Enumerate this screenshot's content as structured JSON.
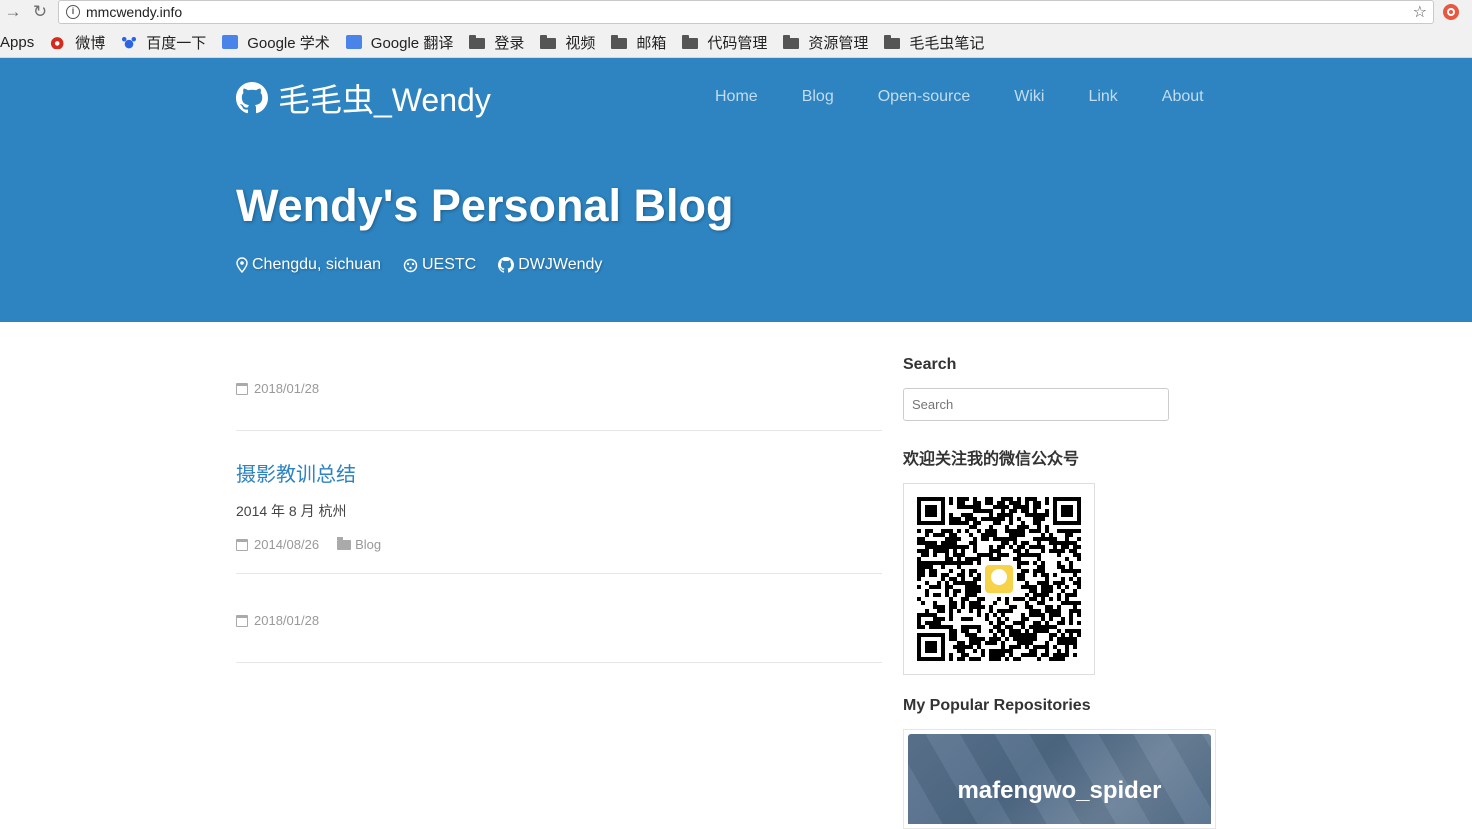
{
  "browser": {
    "url": "mmcwendy.info",
    "bookmarks": [
      {
        "label": "Apps",
        "icon": "apps-icon"
      },
      {
        "label": "微博",
        "icon": "weibo-icon"
      },
      {
        "label": "百度一下",
        "icon": "baidu-icon"
      },
      {
        "label": "Google 学术",
        "icon": "google-scholar-icon"
      },
      {
        "label": "Google 翻译",
        "icon": "google-translate-icon"
      },
      {
        "label": "登录",
        "icon": "folder-icon"
      },
      {
        "label": "视频",
        "icon": "folder-icon"
      },
      {
        "label": "邮箱",
        "icon": "folder-icon"
      },
      {
        "label": "代码管理",
        "icon": "folder-icon"
      },
      {
        "label": "资源管理",
        "icon": "folder-icon"
      },
      {
        "label": "毛毛虫笔记",
        "icon": "folder-icon"
      }
    ]
  },
  "header": {
    "brand": "毛毛虫_Wendy",
    "nav": [
      "Home",
      "Blog",
      "Open-source",
      "Wiki",
      "Link",
      "About"
    ],
    "title": "Wendy's Personal Blog",
    "location": "Chengdu, sichuan",
    "org": "UESTC",
    "github": "DWJWendy",
    "bg_color": "#2d84c1"
  },
  "posts": [
    {
      "title": "",
      "excerpt": "",
      "date": "2018/01/28",
      "category": ""
    },
    {
      "title": "摄影教训总结",
      "excerpt": "2014 年 8 月 杭州",
      "date": "2014/08/26",
      "category": "Blog"
    },
    {
      "title": "",
      "excerpt": "",
      "date": "2018/01/28",
      "category": ""
    }
  ],
  "sidebar": {
    "search_heading": "Search",
    "search_placeholder": "Search",
    "wechat_heading": "欢迎关注我的微信公众号",
    "repos_heading": "My Popular Repositories",
    "repo_name": "mafengwo_spider"
  }
}
